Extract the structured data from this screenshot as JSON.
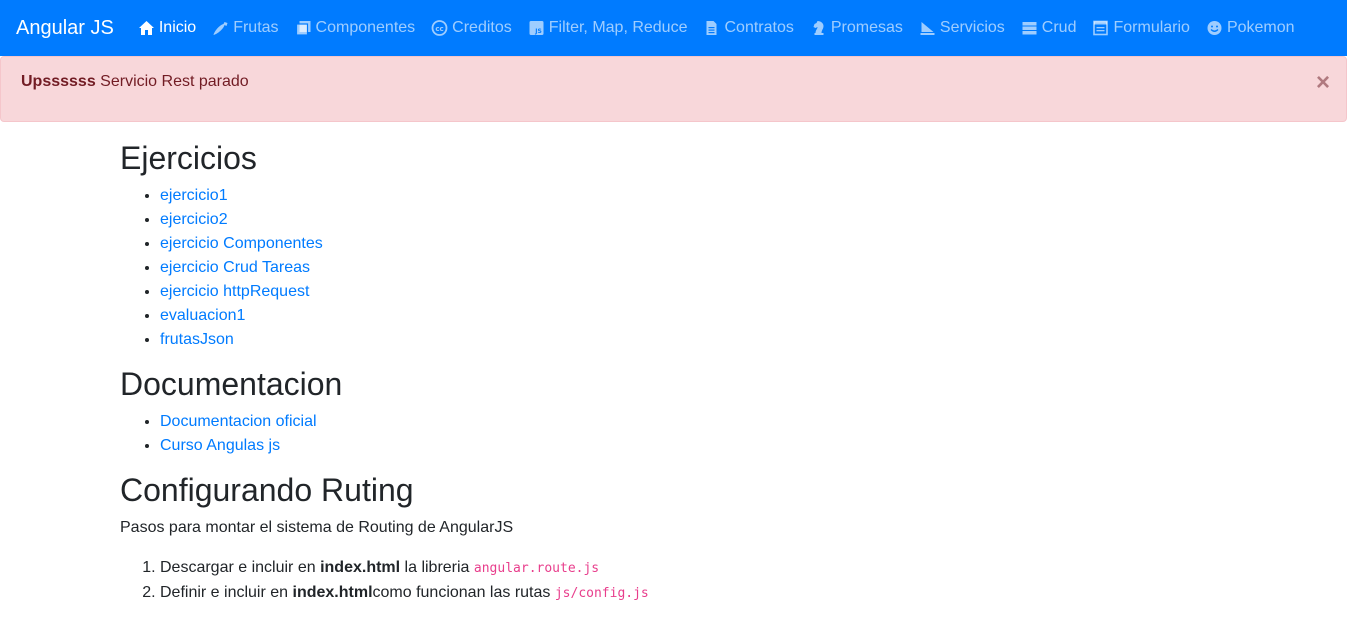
{
  "navbar": {
    "brand": "Angular JS",
    "items": [
      {
        "label": "Inicio",
        "icon": "home-icon",
        "active": true
      },
      {
        "label": "Frutas",
        "icon": "pepper-icon",
        "active": false
      },
      {
        "label": "Componentes",
        "icon": "copy-icon",
        "active": false
      },
      {
        "label": "Creditos",
        "icon": "creative-commons-icon",
        "active": false
      },
      {
        "label": "Filter, Map, Reduce",
        "icon": "js-square-icon",
        "active": false
      },
      {
        "label": "Contratos",
        "icon": "file-icon",
        "active": false
      },
      {
        "label": "Promesas",
        "icon": "chess-knight-icon",
        "active": false
      },
      {
        "label": "Servicios",
        "icon": "sail-icon",
        "active": false
      },
      {
        "label": "Crud",
        "icon": "server-icon",
        "active": false
      },
      {
        "label": "Formulario",
        "icon": "form-icon",
        "active": false
      },
      {
        "label": "Pokemon",
        "icon": "smile-icon",
        "active": false
      }
    ]
  },
  "alert": {
    "strong": "Upssssss",
    "message": " Servicio Rest parado",
    "close": "×"
  },
  "sections": {
    "ejercicios": {
      "title": "Ejercicios",
      "links": [
        "ejercicio1",
        "ejercicio2",
        "ejercicio Componentes",
        "ejercicio Crud Tareas",
        "ejercicio httpRequest",
        "evaluacion1",
        "frutasJson"
      ]
    },
    "documentacion": {
      "title": "Documentacion",
      "links": [
        "Documentacion oficial",
        "Curso Angulas js"
      ]
    },
    "routing": {
      "title": "Configurando Ruting",
      "description": "Pasos para montar el sistema de Routing de AngularJS",
      "steps": [
        {
          "pre": "Descargar e incluir en ",
          "bold": "index.html",
          "mid": " la libreria ",
          "code": "angular.route.js"
        },
        {
          "pre": "Definir e incluir en ",
          "bold": "index.html",
          "mid": "como funcionan las rutas ",
          "code": "js/config.js"
        }
      ]
    }
  },
  "colors": {
    "navbar": "#007bff",
    "alert_bg": "#f8d7da",
    "alert_text": "#721c24",
    "link": "#007bff",
    "code": "#e83e8c"
  }
}
